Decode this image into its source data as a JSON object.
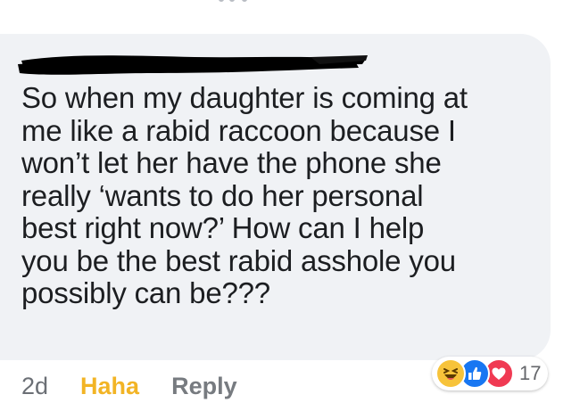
{
  "comment": {
    "text": "So when my daughter is coming at\nme like a rabid raccoon because I\nwon’t let her have the phone she\nreally ‘wants to do her personal\nbest right now?’ How can I help\nyou be the best rabid asshole you\npossibly can be???"
  },
  "meta": {
    "time": "2d",
    "haha_label": "Haha",
    "reply_label": "Reply"
  },
  "reactions": {
    "icons": [
      "haha-icon",
      "like-icon",
      "love-icon"
    ],
    "count": "17"
  },
  "colors": {
    "bubble": "#f0f2f5",
    "text": "#1c1e21",
    "haha": "#f2b425",
    "like": "#1877f2",
    "love": "#f03a53",
    "muted": "#777b80"
  }
}
